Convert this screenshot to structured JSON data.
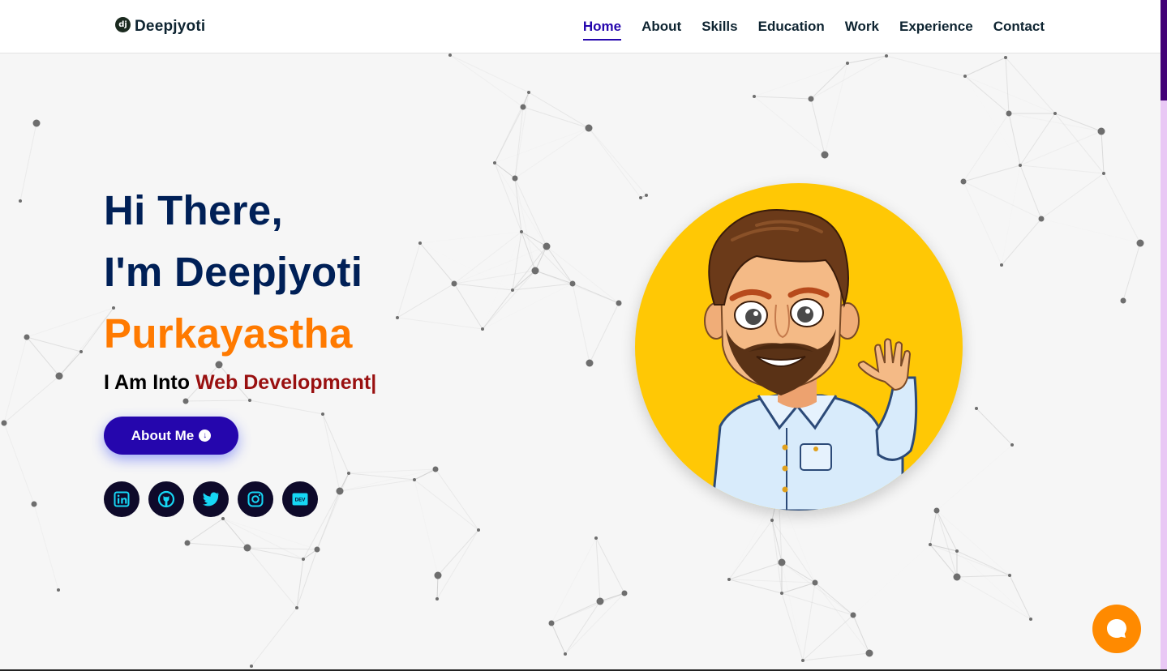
{
  "brand": {
    "icon_text": "dj",
    "name": "Deepjyoti"
  },
  "nav": {
    "items": [
      {
        "label": "Home",
        "active": true
      },
      {
        "label": "About",
        "active": false
      },
      {
        "label": "Skills",
        "active": false
      },
      {
        "label": "Education",
        "active": false
      },
      {
        "label": "Work",
        "active": false
      },
      {
        "label": "Experience",
        "active": false
      },
      {
        "label": "Contact",
        "active": false
      }
    ]
  },
  "hero": {
    "line1": "Hi There,",
    "line2": "I'm Deepjyoti",
    "line3": "Purkayastha",
    "typing_prefix": "I Am Into",
    "typing_text": "Web Development",
    "caret": "|",
    "button_label": "About Me"
  },
  "socials": [
    {
      "icon": "linkedin-icon"
    },
    {
      "icon": "github-icon"
    },
    {
      "icon": "twitter-icon"
    },
    {
      "icon": "instagram-icon"
    },
    {
      "icon": "dev-icon",
      "text": "DEV"
    }
  ],
  "colors": {
    "navy": "#002057",
    "orange": "#ff7a00",
    "accent_red": "#991010",
    "button": "#2506ad",
    "avatar_bg": "#ffc805",
    "chat": "#ff8a00"
  }
}
